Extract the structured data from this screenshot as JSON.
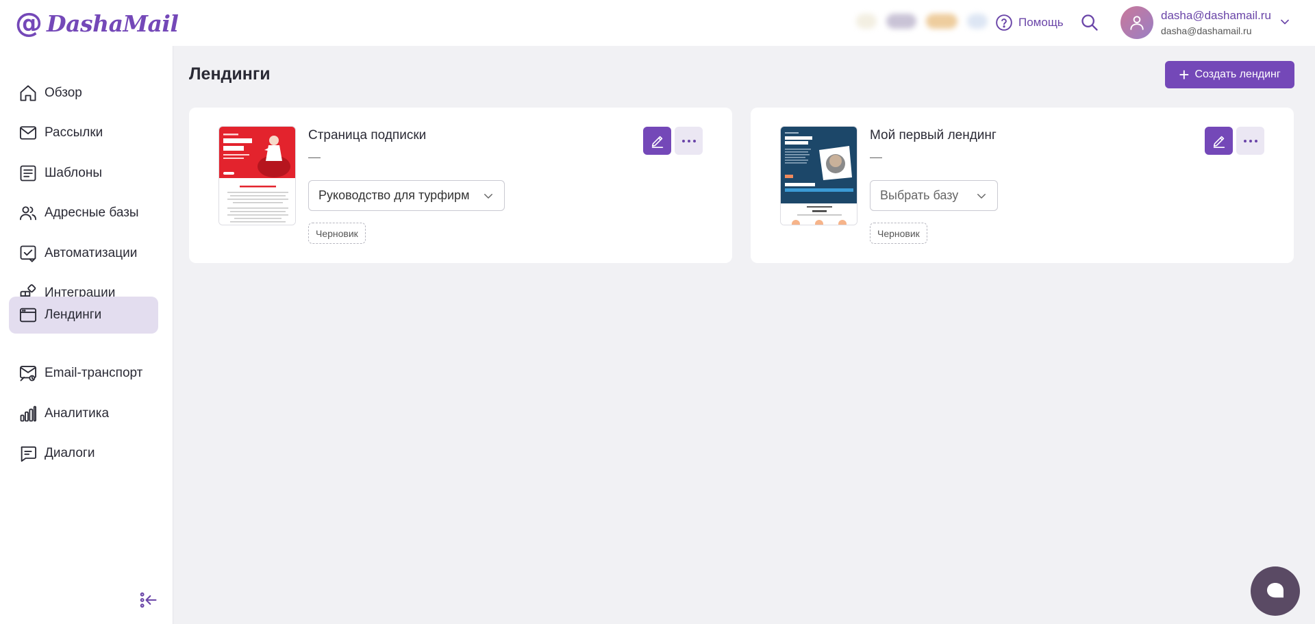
{
  "header": {
    "logo_text": "DashaMail",
    "logo_at": "@",
    "help_label": "Помощь",
    "user_email": "dasha@dashamail.ru",
    "user_email_secondary": "dasha@dashamail.ru",
    "icons": [
      "help-icon",
      "search-icon",
      "user-icon",
      "chevron-down-icon"
    ]
  },
  "sidebar": {
    "items": [
      {
        "label": "Обзор",
        "icon": "home-icon"
      },
      {
        "label": "Рассылки",
        "icon": "mail-icon"
      },
      {
        "label": "Шаблоны",
        "icon": "template-icon"
      },
      {
        "label": "Адресные базы",
        "icon": "contacts-icon"
      },
      {
        "label": "Автоматизации",
        "icon": "automation-icon"
      },
      {
        "label": "Интеграции",
        "icon": "integrations-icon"
      },
      {
        "label": "Лендинги",
        "icon": "landing-icon",
        "active": true
      },
      {
        "label": "Email-транспорт",
        "icon": "transport-icon"
      },
      {
        "label": "Аналитика",
        "icon": "analytics-icon"
      },
      {
        "label": "Диалоги",
        "icon": "dialogs-icon"
      }
    ],
    "collapse_icon": "collapse-icon"
  },
  "main": {
    "title": "Лендинги",
    "create_button": "Создать лендинг",
    "cards": [
      {
        "title": "Страница подписки",
        "subtitle": "—",
        "select_value": "Руководство для турфирм",
        "status": "Черновик"
      },
      {
        "title": "Мой первый лендинг",
        "subtitle": "—",
        "select_value": "Выбрать базу",
        "status": "Черновик"
      }
    ]
  },
  "colors": {
    "accent": "#7448b8",
    "accent_light": "#e3ddef",
    "background": "#f1f1f4",
    "chat": "#5a4a64"
  },
  "chat_icon": "chat-icon"
}
